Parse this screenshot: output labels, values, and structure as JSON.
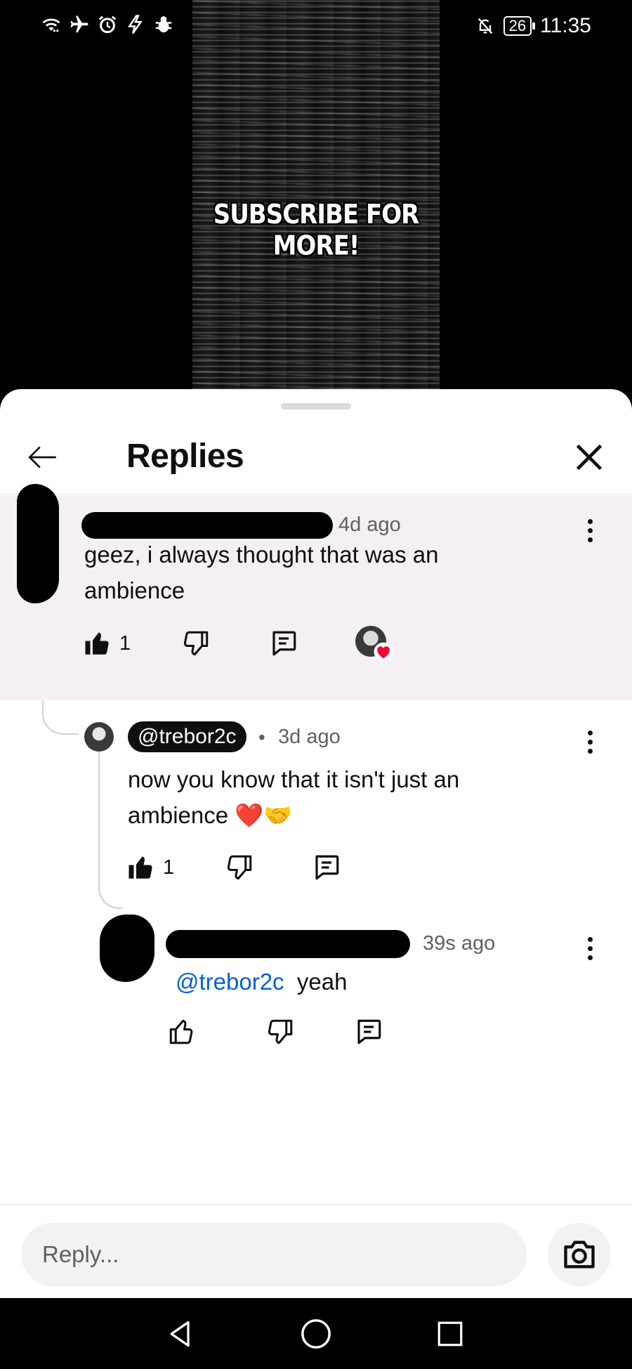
{
  "status_bar": {
    "battery": "26",
    "time": "11:35",
    "left_icons": [
      "wifi-icon",
      "airplane-icon",
      "alarm-icon",
      "flash-icon",
      "bug-icon"
    ],
    "right_icons": [
      "bell-off-icon",
      "battery-icon"
    ]
  },
  "video": {
    "caption": "SUBSCRIBE FOR MORE!"
  },
  "sheet": {
    "title": "Replies"
  },
  "parent_comment": {
    "time": "4d ago",
    "text": "geez, i always thought that was an ambience",
    "likes": "1",
    "creator_heart": true
  },
  "reply_1": {
    "author": "@trebor2c",
    "separator": "•",
    "time": "3d ago",
    "text": "now you know that it isn't just an ambience ❤️🤝",
    "likes": "1"
  },
  "reply_2": {
    "time": "39s ago",
    "mention": "@trebor2c",
    "text": "yeah"
  },
  "reply_bar": {
    "placeholder": "Reply..."
  },
  "colors": {
    "highlight": "#f4f0f4",
    "mention": "#065fd4",
    "heart": "#ff0033"
  }
}
